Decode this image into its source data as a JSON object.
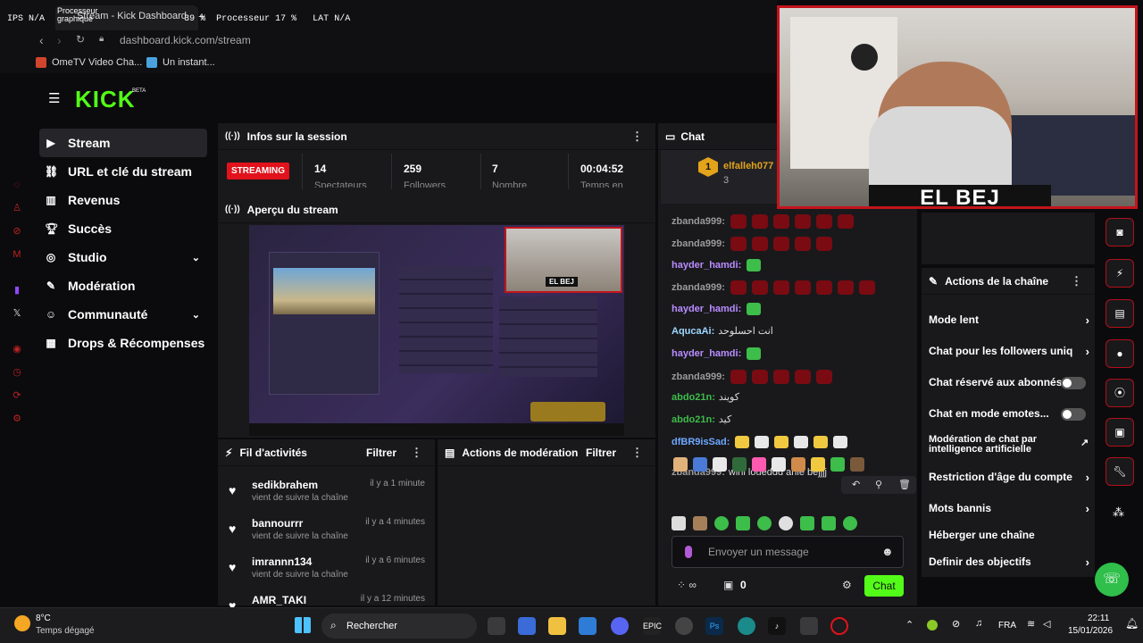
{
  "browser": {
    "tab_title": "Stream - Kick Dashboard",
    "url": "dashboard.kick.com/stream",
    "bookmarks": [
      "OmeTV Video Cha...",
      "Un instant..."
    ]
  },
  "overlay": {
    "ips_label": "IPS",
    "ips_value": "N/A",
    "gpu_label": "Processeur graphique",
    "gpu_value": "39 %",
    "cpu_label": "Processeur",
    "cpu_value": "17 %",
    "lat_label": "LAT",
    "lat_value": "N/A"
  },
  "logo": "KICK",
  "logo_beta": "BETA",
  "nav": [
    {
      "label": "Stream",
      "icon": "video-icon",
      "active": true
    },
    {
      "label": "URL et clé du stream",
      "icon": "link-icon"
    },
    {
      "label": "Revenus",
      "icon": "chart-icon"
    },
    {
      "label": "Succès",
      "icon": "trophy-icon"
    },
    {
      "label": "Studio",
      "icon": "camera-icon",
      "chevron": true
    },
    {
      "label": "Modération",
      "icon": "wrench-icon"
    },
    {
      "label": "Communauté",
      "icon": "people-icon",
      "chevron": true
    },
    {
      "label": "Drops & Récompenses",
      "icon": "gift-icon"
    }
  ],
  "session": {
    "title": "Infos sur la session",
    "badge": "STREAMING",
    "stats": [
      {
        "value": "14",
        "label": "Spectateurs"
      },
      {
        "value": "259",
        "label": "Followers"
      },
      {
        "value": "7",
        "label": "Nombre"
      },
      {
        "value": "00:04:52",
        "label": "Temps en"
      }
    ]
  },
  "preview": {
    "title": "Aperçu du stream",
    "webcam_name": "EL BEJ"
  },
  "activity": {
    "title": "Fil d'activités",
    "filter": "Filtrer",
    "items": [
      {
        "user": "sedikbrahem",
        "time": "il y a 1 minute",
        "text": "vient de suivre la chaîne"
      },
      {
        "user": "bannourrr",
        "time": "il y a 4 minutes",
        "text": "vient de suivre la chaîne"
      },
      {
        "user": "imrannn134",
        "time": "il y a 6 minutes",
        "text": "vient de suivre la chaîne"
      },
      {
        "user": "AMR_TAKI",
        "time": "il y a 12 minutes",
        "text": ""
      }
    ]
  },
  "modactions": {
    "title": "Actions de modération",
    "filter": "Filtrer"
  },
  "chat": {
    "title": "Chat",
    "pinned_user": "elfalleh077",
    "pinned_count": "3",
    "messages": [
      {
        "user": "zbanda999",
        "color": "#9a9a9a",
        "type": "hearts",
        "n": 6
      },
      {
        "user": "zbanda999",
        "color": "#9a9a9a",
        "type": "hearts",
        "n": 5
      },
      {
        "user": "hayder_hamdi",
        "color": "#b98cff",
        "type": "green"
      },
      {
        "user": "zbanda999",
        "color": "#9a9a9a",
        "type": "hearts",
        "n": 7
      },
      {
        "user": "hayder_hamdi",
        "color": "#b98cff",
        "type": "green"
      },
      {
        "user": "AqucaAi",
        "color": "#9ed7ff",
        "type": "text",
        "text": "انت احسلوحد"
      },
      {
        "user": "hayder_hamdi",
        "color": "#b98cff",
        "type": "green"
      },
      {
        "user": "zbanda999",
        "color": "#9a9a9a",
        "type": "hearts",
        "n": 5
      },
      {
        "user": "abdo21n",
        "color": "#3dbd4a",
        "type": "text",
        "text": "كويند"
      },
      {
        "user": "abdo21n",
        "color": "#3dbd4a",
        "type": "text",
        "text": "كيد"
      },
      {
        "user": "dfBR9isSad",
        "color": "#6ea8ff",
        "type": "emotes"
      },
      {
        "user": "zbanda999",
        "color": "#9a9a9a",
        "type": "text",
        "text": "wini loueddd ahle bejjjj"
      }
    ],
    "input_placeholder": "Envoyer un message",
    "send": "Chat",
    "points": "0"
  },
  "channel_actions": {
    "title": "Actions de la chaîne",
    "items": [
      {
        "label": "Mode lent",
        "kind": "arrow"
      },
      {
        "label": "Chat pour les followers uniq",
        "kind": "arrow"
      },
      {
        "label": "Chat réservé aux abonnés",
        "kind": "toggle"
      },
      {
        "label": "Chat en mode emotes...",
        "kind": "toggle"
      },
      {
        "label": "Modération de chat par intelligence artificielle",
        "kind": "ext"
      },
      {
        "label": "Restriction d'âge du compte",
        "kind": "arrow"
      },
      {
        "label": "Mots bannis",
        "kind": "arrow"
      },
      {
        "label": "Héberger une chaîne",
        "kind": "none"
      },
      {
        "label": "Definir des objectifs",
        "kind": "arrow"
      }
    ]
  },
  "webcam": {
    "name": "EL BEJ"
  },
  "taskbar": {
    "temp": "8°C",
    "weather": "Temps dégagé",
    "search": "Rechercher",
    "lang": "FRA",
    "time": "22:11",
    "date": "15/01/2026"
  },
  "colors": {
    "accent": "#53fc18",
    "streaming": "#e1121b",
    "bg": "#0b0b0d",
    "panel": "#19191c"
  }
}
